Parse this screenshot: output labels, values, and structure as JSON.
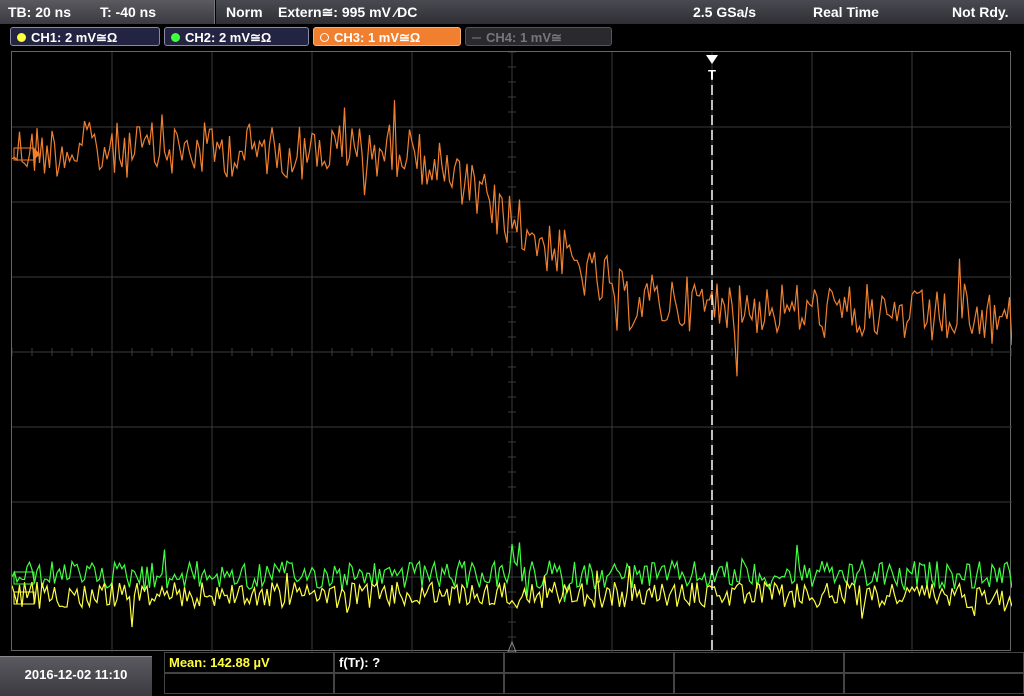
{
  "topbar": {
    "timebase": "TB: 20 ns",
    "trigger_offset": "T: -40 ns",
    "mode": "Norm",
    "trigger_source": "Extern≅: 995 mV ⁄DC",
    "sample_rate": "2.5 GSa/s",
    "acq_mode": "Real Time",
    "state": "Not Rdy."
  },
  "channels": [
    {
      "label": "CH1: 2 mV≅Ω",
      "color": "#ffff40",
      "active": true
    },
    {
      "label": "CH2: 2 mV≅Ω",
      "color": "#40ff40",
      "active": true
    },
    {
      "label": "CH3: 1 mV≅Ω",
      "color": "#f08030",
      "active": true,
      "selected": true
    },
    {
      "label": "CH4: 1 mV≅",
      "color": "#888888",
      "active": false
    }
  ],
  "colors": {
    "ch1": "#ffff40",
    "ch2": "#40ff40",
    "ch3": "#f08030",
    "grid": "#3a3a3a",
    "cursor": "#ffffff"
  },
  "trigger_marker": "T",
  "bottom": {
    "datetime": "2016-12-02 11:10",
    "meas1": "Mean: 142.88 µV",
    "meas2": "f(Tr): ?"
  }
}
